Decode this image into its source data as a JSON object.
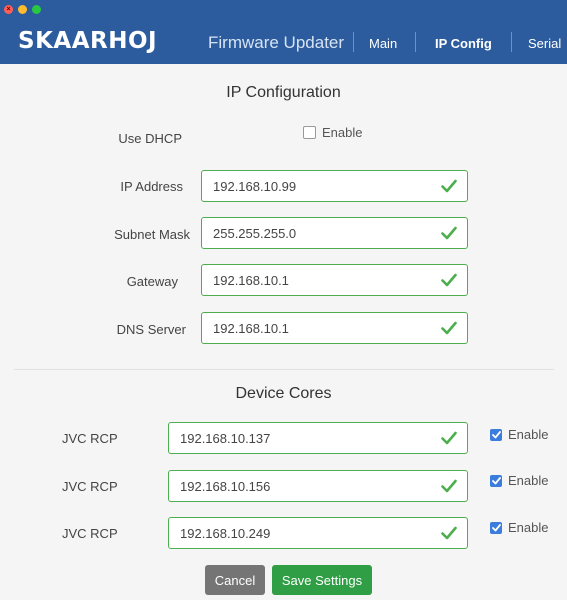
{
  "header": {
    "brand": "SKAARHOJ",
    "app_title": "Firmware Updater",
    "nav": [
      {
        "label": "Main",
        "active": false
      },
      {
        "label": "IP Config",
        "active": true
      },
      {
        "label": "Serial",
        "active": false
      }
    ]
  },
  "ip_config": {
    "title": "IP Configuration",
    "dhcp": {
      "label": "Use DHCP",
      "checkbox_label": "Enable",
      "checked": false
    },
    "fields": [
      {
        "label": "IP Address",
        "value": "192.168.10.99",
        "valid": true
      },
      {
        "label": "Subnet Mask",
        "value": "255.255.255.0",
        "valid": true
      },
      {
        "label": "Gateway",
        "value": "192.168.10.1",
        "valid": true
      },
      {
        "label": "DNS Server",
        "value": "192.168.10.1",
        "valid": true
      }
    ]
  },
  "device_cores": {
    "title": "Device Cores",
    "items": [
      {
        "label": "JVC RCP",
        "value": "192.168.10.137",
        "enable_label": "Enable",
        "enabled": true,
        "valid": true
      },
      {
        "label": "JVC RCP",
        "value": "192.168.10.156",
        "enable_label": "Enable",
        "enabled": true,
        "valid": true
      },
      {
        "label": "JVC RCP",
        "value": "192.168.10.249",
        "enable_label": "Enable",
        "enabled": true,
        "valid": true
      }
    ]
  },
  "actions": {
    "cancel": "Cancel",
    "save": "Save Settings"
  },
  "colors": {
    "header": "#2c5c9e",
    "valid": "#4cae4c",
    "save": "#2f9e44",
    "cancel": "#757575",
    "checkbox": "#3b7ddd"
  },
  "icons": [
    "close-dot",
    "minimize-dot",
    "zoom-dot",
    "checkmark-icon",
    "checkbox-checked-icon"
  ]
}
